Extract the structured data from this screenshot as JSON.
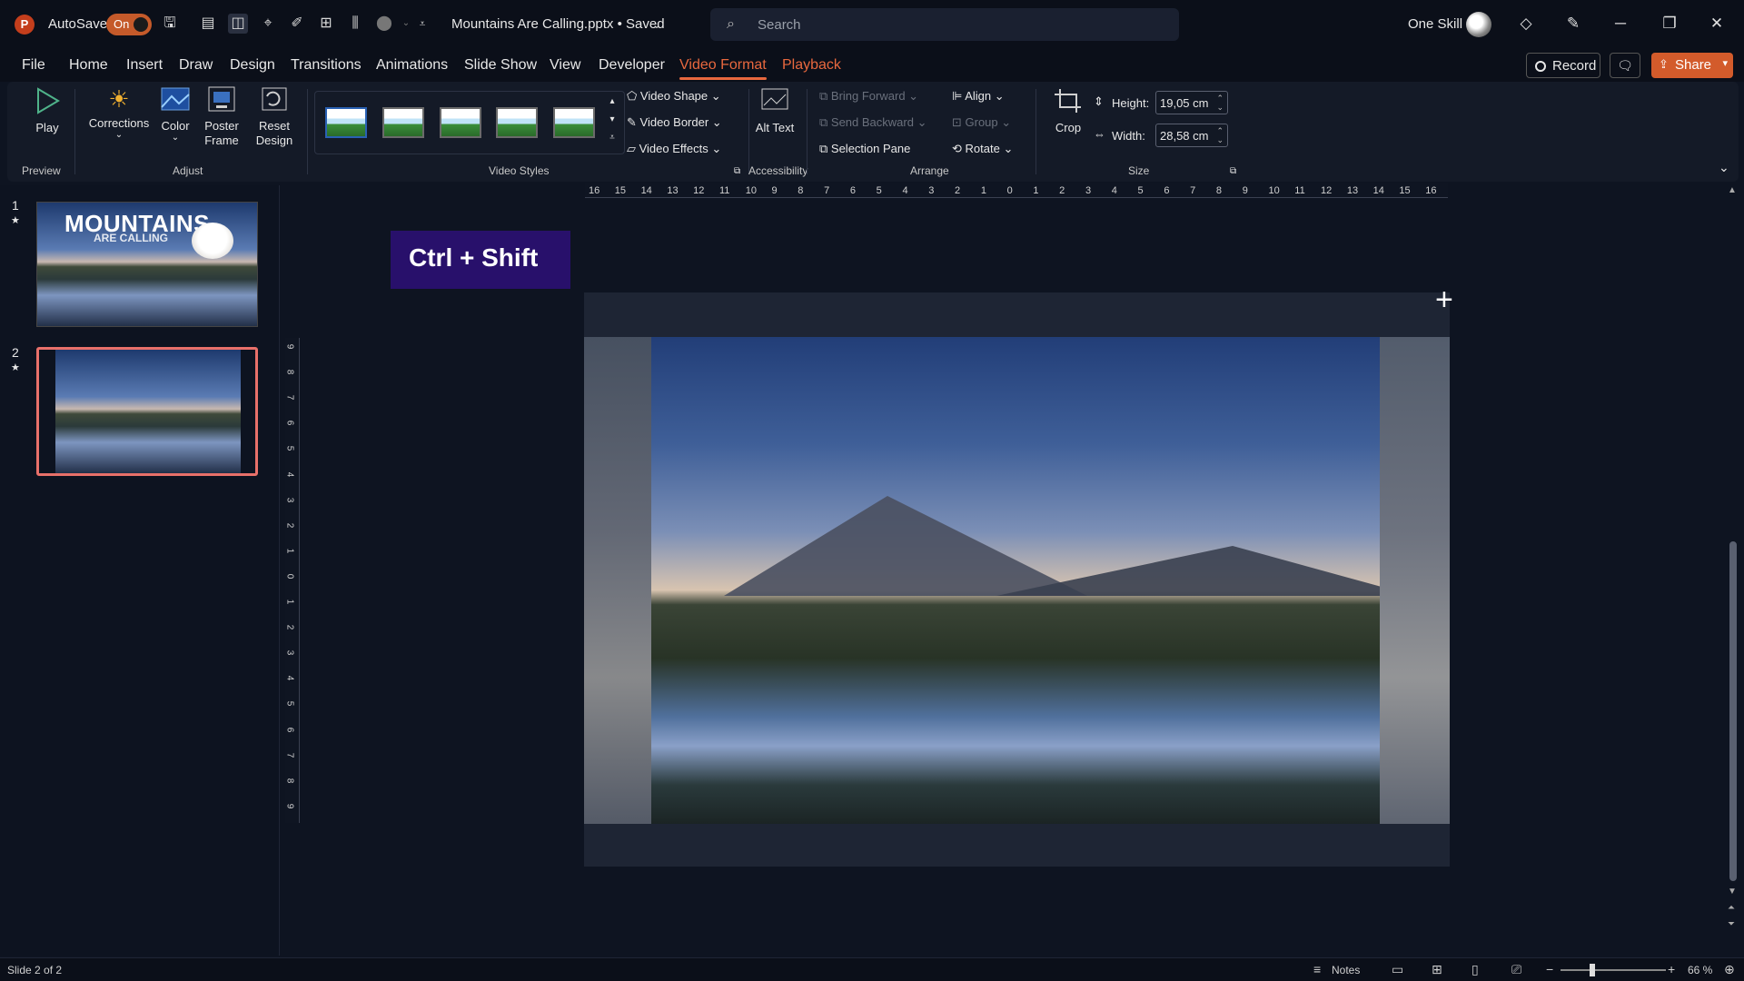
{
  "titlebar": {
    "autosave_label": "AutoSave",
    "autosave_state": "On",
    "document_title": "Mountains Are Calling.pptx • Saved",
    "search_placeholder": "Search",
    "user_name": "One Skill",
    "accent_color": "#c55a2a"
  },
  "menu": {
    "tabs": [
      "File",
      "Home",
      "Insert",
      "Draw",
      "Design",
      "Transitions",
      "Animations",
      "Slide Show",
      "View",
      "Developer",
      "Video Format",
      "Playback"
    ],
    "active_tab": "Video Format",
    "record_label": "Record",
    "share_label": "Share"
  },
  "ribbon": {
    "preview": {
      "play_label": "Play",
      "group_label": "Preview"
    },
    "adjust": {
      "corrections_label": "Corrections",
      "color_label": "Color",
      "poster_frame_label": "Poster Frame",
      "reset_design_label": "Reset Design",
      "group_label": "Adjust"
    },
    "video_styles": {
      "group_label": "Video Styles",
      "thumb_count": 5,
      "video_shape_label": "Video Shape",
      "video_border_label": "Video Border",
      "video_effects_label": "Video Effects"
    },
    "accessibility": {
      "alt_text_label": "Alt Text",
      "group_label": "Accessibility"
    },
    "arrange": {
      "bring_forward_label": "Bring Forward",
      "send_backward_label": "Send Backward",
      "selection_pane_label": "Selection Pane",
      "align_label": "Align",
      "group_label_btn": "Group",
      "rotate_label": "Rotate",
      "group_label": "Arrange"
    },
    "size": {
      "crop_label": "Crop",
      "height_label": "Height:",
      "height_value": "19,05 cm",
      "width_label": "Width:",
      "width_value": "28,58 cm",
      "group_label": "Size"
    }
  },
  "slides": [
    {
      "number": "1",
      "title": "MOUNTAINS",
      "subtitle": "ARE CALLING",
      "selected": false
    },
    {
      "number": "2",
      "selected": true
    }
  ],
  "ruler": {
    "horizontal": [
      "16",
      "15",
      "14",
      "13",
      "12",
      "11",
      "10",
      "9",
      "8",
      "7",
      "6",
      "5",
      "4",
      "3",
      "2",
      "1",
      "0",
      "1",
      "2",
      "3",
      "4",
      "5",
      "6",
      "7",
      "8",
      "9",
      "10",
      "11",
      "12",
      "13",
      "14",
      "15",
      "16"
    ],
    "vertical": [
      "9",
      "8",
      "7",
      "6",
      "5",
      "4",
      "3",
      "2",
      "1",
      "0",
      "1",
      "2",
      "3",
      "4",
      "5",
      "6",
      "7",
      "8",
      "9"
    ]
  },
  "canvas": {
    "overlay_text": "Ctrl + Shift",
    "overlay_color": "#28106b"
  },
  "statusbar": {
    "slide_info": "Slide 2 of 2",
    "notes_label": "Notes",
    "zoom_level": "66 %"
  }
}
